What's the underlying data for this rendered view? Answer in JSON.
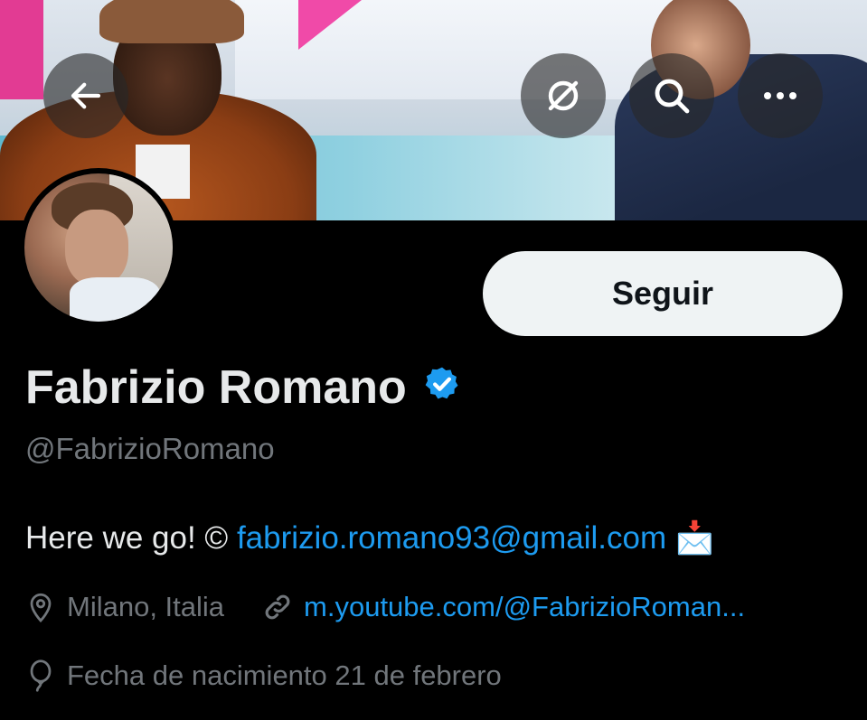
{
  "header": {
    "back_icon": "arrow-left-icon",
    "grok_icon": "grok-icon",
    "search_icon": "search-icon",
    "more_icon": "more-horizontal-icon"
  },
  "profile": {
    "follow_label": "Seguir",
    "display_name": "Fabrizio Romano",
    "verified_icon": "verified-badge-icon",
    "handle": "@FabrizioRomano",
    "bio_text": "Here we go! © ",
    "bio_email": "fabrizio.romano93@gmail.com",
    "bio_emoji": "📩",
    "location": "Milano, Italia",
    "website": "m.youtube.com/@FabrizioRoman...",
    "birthday": "Fecha de nacimiento 21 de febrero"
  },
  "colors": {
    "accent": "#1d9bf0",
    "secondary_text": "#71767b",
    "primary_text": "#e7e9ea",
    "background": "#000000"
  }
}
